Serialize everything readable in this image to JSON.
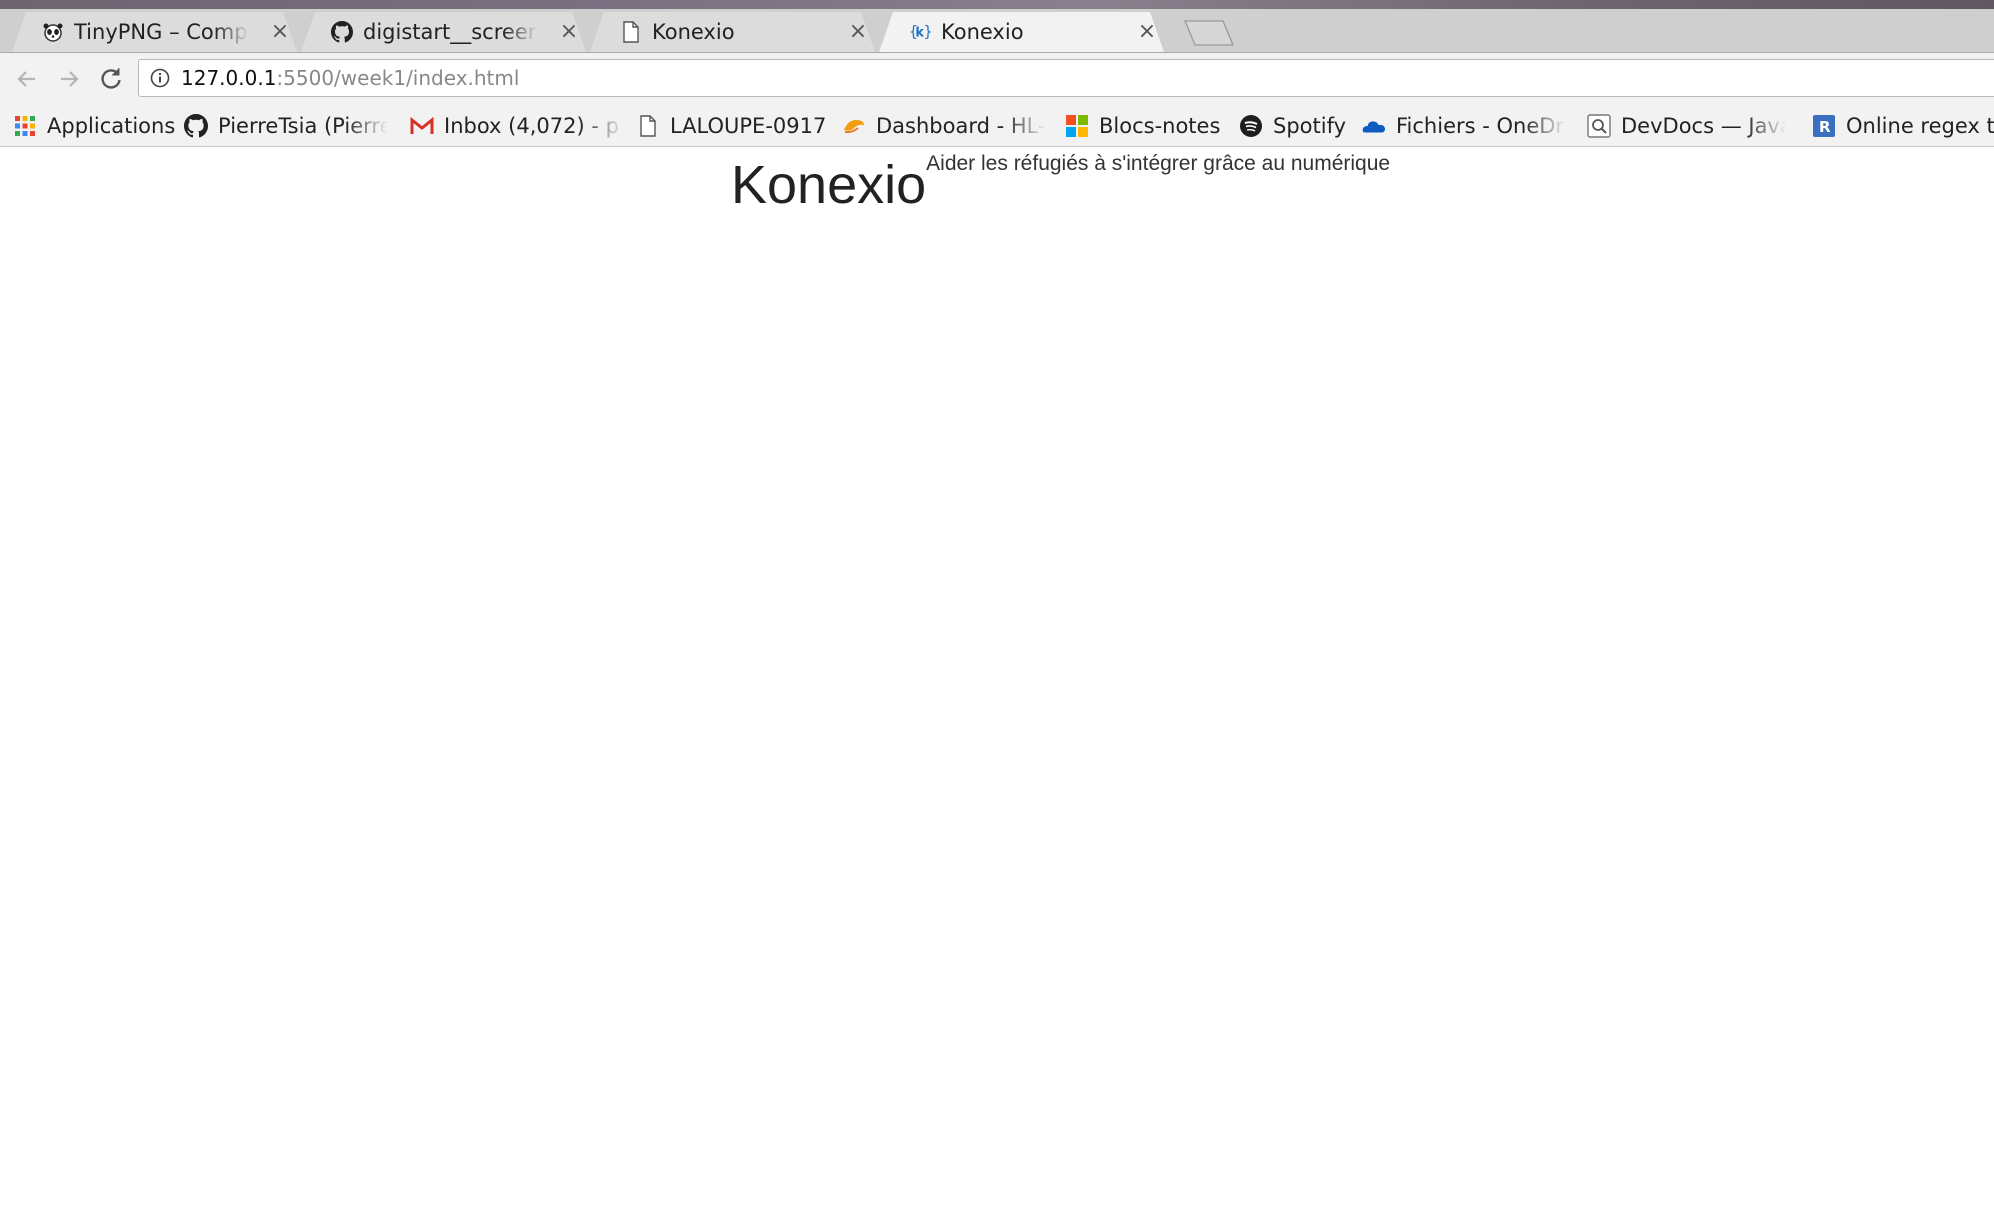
{
  "tabs": [
    {
      "title": "TinyPNG – Compress PNG images",
      "icon": "tinypng-panda-icon",
      "active": false
    },
    {
      "title": "digistart__screenshots",
      "icon": "github-icon",
      "active": false
    },
    {
      "title": "Konexio",
      "icon": "page-icon",
      "active": false
    },
    {
      "title": "Konexio",
      "icon": "konexio-k-icon",
      "active": true
    }
  ],
  "tab_close_glyph": "×",
  "address_bar": {
    "url_host": "127.0.0.1",
    "url_path": ":5500/week1/index.html"
  },
  "bookmarks": [
    {
      "label": "Applications",
      "icon": "apps-grid-icon"
    },
    {
      "label": "PierreTsia (Pierre",
      "icon": "github-icon"
    },
    {
      "label": "Inbox (4,072) - p",
      "icon": "gmail-icon"
    },
    {
      "label": "LALOUPE-0917",
      "icon": "page-icon"
    },
    {
      "label": "Dashboard - HL-J",
      "icon": "dashboard-icon"
    },
    {
      "label": "Blocs-notes",
      "icon": "microsoft-icon"
    },
    {
      "label": "Spotify",
      "icon": "spotify-icon"
    },
    {
      "label": "Fichiers - OneDri",
      "icon": "onedrive-icon"
    },
    {
      "label": "DevDocs — Java",
      "icon": "devdocs-icon"
    },
    {
      "label": "Online regex te",
      "icon": "regex-r-icon"
    }
  ],
  "page": {
    "title": "Konexio",
    "tagline": "Aider les réfugiés à s'intégrer grâce au numérique"
  },
  "colors": {
    "tabbar_bg": "#cfcfcf",
    "toolbar_bg": "#f2f2f2",
    "page_bg": "#ffffff",
    "konexio_blue": "#1a73c8"
  }
}
